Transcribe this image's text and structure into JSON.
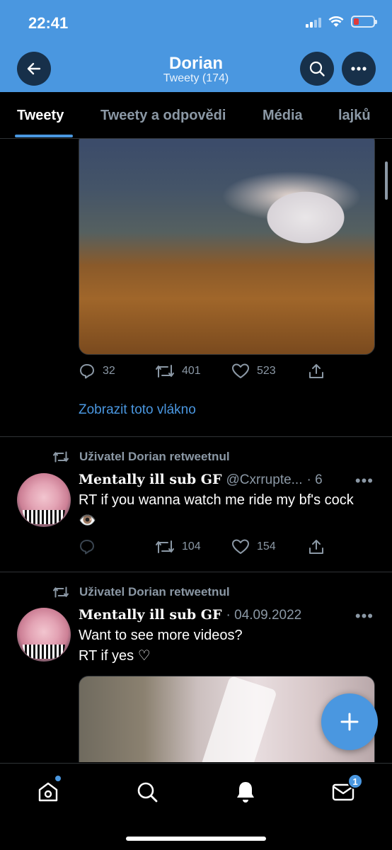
{
  "status_bar": {
    "time": "22:41"
  },
  "header": {
    "title": "Dorian",
    "subtitle": "Tweety (174)",
    "icons": {
      "back": "arrow-left-icon",
      "search": "search-icon",
      "more": "ellipsis-icon"
    }
  },
  "tabs": [
    {
      "label": "Tweety",
      "active": true
    },
    {
      "label": "Tweety a odpovědi",
      "active": false
    },
    {
      "label": "Média",
      "active": false
    },
    {
      "label": "lajků",
      "active": false
    }
  ],
  "tweet1": {
    "replies": "32",
    "retweets": "401",
    "likes": "523",
    "thread_link": "Zobrazit toto vlákno"
  },
  "tweet2": {
    "retweeted_by": "Uživatel Dorian retweetnul",
    "name": "Mentally ill sub GF",
    "handle": "@Cxrrupte...",
    "time": "· 6 d",
    "text": "RT if you wanna watch me ride my bf's cock 👁️",
    "retweets": "104",
    "likes": "154"
  },
  "tweet3": {
    "retweeted_by": "Uživatel Dorian retweetnul",
    "name": "Mentally ill sub GF",
    "time": "· 04.09.2022",
    "text_line1": "Want to see more videos?",
    "text_line2": "RT if yes ♡"
  },
  "bottom_nav": {
    "items": [
      "home-icon",
      "search-icon",
      "notifications-icon",
      "messages-icon"
    ],
    "messages_badge": "1"
  },
  "colors": {
    "accent": "#4a97e0",
    "header_bg": "#4a97e0",
    "background": "#000000",
    "muted": "#8b98a5"
  }
}
